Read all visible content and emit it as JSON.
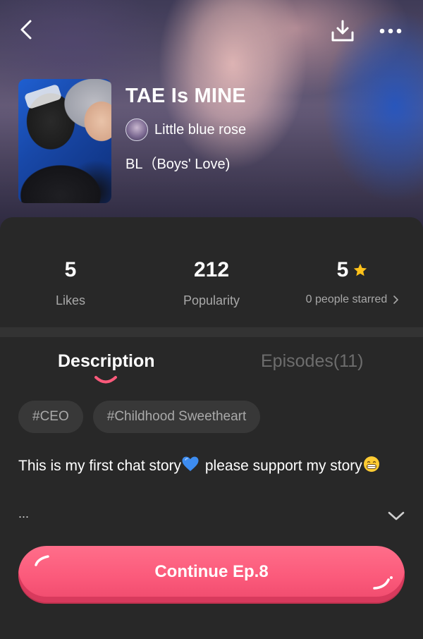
{
  "header": {
    "back_icon": "chevron-left-icon",
    "download_icon": "download-icon",
    "more_icon": "more-horizontal-icon"
  },
  "story": {
    "title": "TAE Is MINE",
    "author": "Little blue rose",
    "genre": "BL（Boys' Love)"
  },
  "stats": {
    "likes_value": "5",
    "likes_label": "Likes",
    "popularity_value": "212",
    "popularity_label": "Popularity",
    "rating_value": "5",
    "rating_label": "0 people starred"
  },
  "tabs": {
    "description": "Description",
    "episodes": "Episodes(11)"
  },
  "tags": [
    "#CEO",
    "#Childhood Sweetheart"
  ],
  "description": {
    "part1": "This is my first chat story",
    "part2": " please support my story",
    "ellipsis": "..."
  },
  "cta": {
    "label": "Continue Ep.8"
  },
  "colors": {
    "accent": "#fb5a7b",
    "star": "#ffc21a",
    "background": "#282828",
    "muted_text": "#a8a8a8"
  }
}
